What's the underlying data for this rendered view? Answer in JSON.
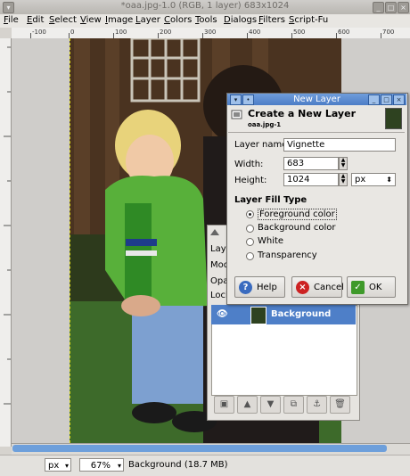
{
  "window": {
    "title": "*oaa.jpg-1.0 (RGB, 1 layer) 683x1024"
  },
  "menubar": [
    {
      "label": "File",
      "key": "F",
      "rest": "ile"
    },
    {
      "label": "Edit",
      "key": "E",
      "rest": "dit"
    },
    {
      "label": "Select",
      "key": "S",
      "rest": "elect"
    },
    {
      "label": "View",
      "key": "V",
      "rest": "iew"
    },
    {
      "label": "Image",
      "key": "I",
      "rest": "mage"
    },
    {
      "label": "Layer",
      "key": "L",
      "rest": "ayer"
    },
    {
      "label": "Colors",
      "key": "C",
      "rest": "olors"
    },
    {
      "label": "Tools",
      "key": "T",
      "rest": "ools"
    },
    {
      "label": "Dialogs",
      "key": "D",
      "rest": "ialogs"
    },
    {
      "label": "Filters",
      "key": "F",
      "rest": "ilters"
    },
    {
      "label": "Script-Fu",
      "key": "S",
      "rest": "cript-Fu"
    }
  ],
  "ruler": {
    "top_ticks": [
      "-100",
      "0",
      "100",
      "200",
      "300",
      "400",
      "500",
      "600",
      "700"
    ]
  },
  "status": {
    "unit": "px",
    "zoom": "67%",
    "text": "Background (18.7 MB)"
  },
  "layers_dock": {
    "rows": [
      "Laye",
      "Mod",
      "Opa",
      "Lock"
    ],
    "layer_name": "Background"
  },
  "dialog": {
    "title": "New Layer",
    "heading": "Create a New Layer",
    "subheading": "oaa.jpg-1",
    "layer_name_label": "Layer name:",
    "layer_name_value": "Vignette",
    "width_label": "Width:",
    "width_value": "683",
    "height_label": "Height:",
    "height_value": "1024",
    "unit": "px",
    "fill_type_label": "Layer Fill Type",
    "fill_options": [
      "Foreground color",
      "Background color",
      "White",
      "Transparency"
    ],
    "selected_fill": 0,
    "help_label": "Help",
    "cancel_label": "Cancel",
    "ok_label": "OK"
  }
}
